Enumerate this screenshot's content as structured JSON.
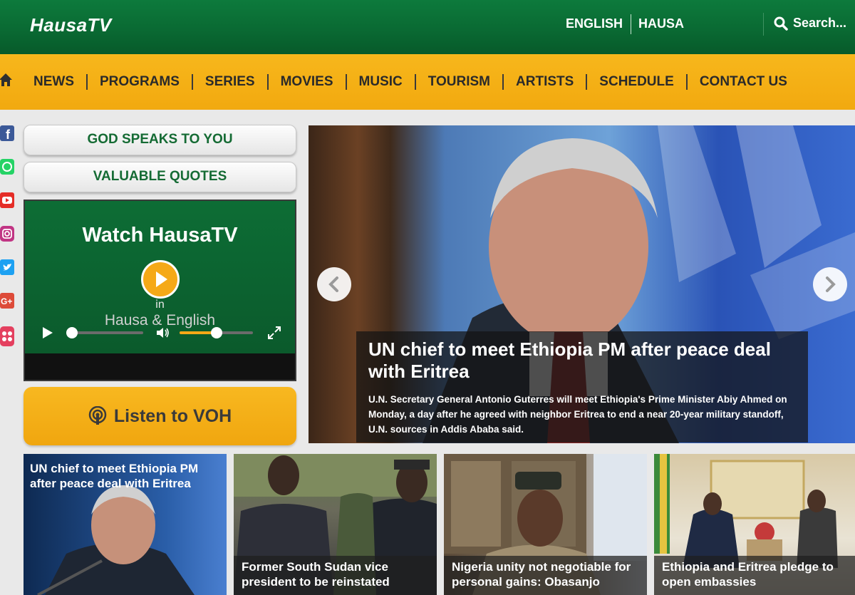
{
  "header": {
    "logo": "HausaTV",
    "languages": [
      "ENGLISH",
      "HAUSA"
    ],
    "search_label": "Search..."
  },
  "nav": {
    "home_icon": "home-icon",
    "items": [
      "NEWS",
      "PROGRAMS",
      "SERIES",
      "MOVIES",
      "MUSIC",
      "TOURISM",
      "ARTISTS",
      "SCHEDULE",
      "CONTACT US"
    ]
  },
  "social": [
    {
      "icon": "facebook-icon",
      "color": "#3b5998"
    },
    {
      "icon": "whatsapp-icon",
      "color": "#25d366"
    },
    {
      "icon": "youtube-icon",
      "color": "#e52d27"
    },
    {
      "icon": "instagram-icon",
      "color": "#c13584"
    },
    {
      "icon": "twitter-icon",
      "color": "#1da1f2"
    },
    {
      "icon": "google-plus-icon",
      "color": "#dd4b39"
    },
    {
      "icon": "flickr-icon",
      "color": "#e4405f"
    }
  ],
  "sidebar": {
    "buttons": [
      "GOD SPEAKS TO YOU",
      "VALUABLE QUOTES"
    ],
    "player": {
      "title": "Watch HausaTV",
      "line1": "in",
      "line2": "Hausa & English",
      "progress": 0,
      "volume": 0.5
    },
    "listen_label": "Listen to VOH"
  },
  "slider": {
    "title": "UN chief to meet Ethiopia PM after peace deal with Eritrea",
    "description": "U.N. Secretary General Antonio Guterres will meet Ethiopia's Prime Minister Abiy Ahmed on Monday, a day after he agreed with neighbor Eritrea to end a near 20-year military standoff, U.N. sources in Addis Ababa said."
  },
  "cards": [
    {
      "title": "UN chief to meet Ethiopia PM after peace deal with Eritrea"
    },
    {
      "title": "Former South Sudan vice president to be reinstated"
    },
    {
      "title": "Nigeria unity not negotiable for personal gains: Obasanjo"
    },
    {
      "title": "Ethiopia and Eritrea pledge to open embassies"
    }
  ],
  "colors": {
    "header_green": "#0a6a33",
    "nav_yellow": "#f2a90f",
    "button_text_green": "#156b34"
  }
}
